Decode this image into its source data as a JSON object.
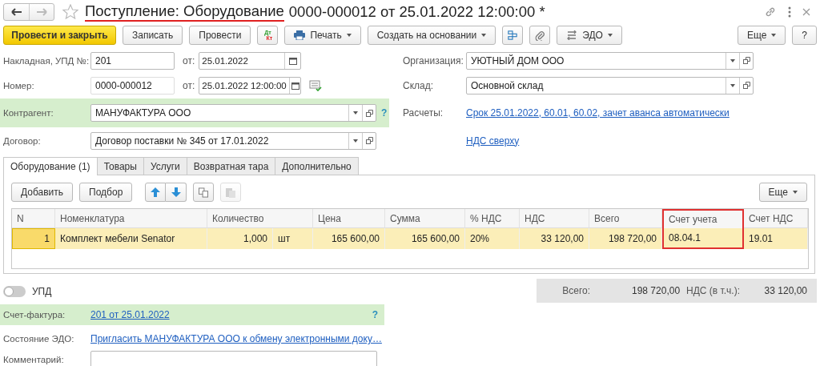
{
  "nav": [
    {
      "kind": "back",
      "disabled": false
    },
    {
      "kind": "forward",
      "disabled": true
    }
  ],
  "title": [
    {
      "text": "Поступление: Оборудование",
      "marked": true
    },
    {
      "text": "0000-000012 от 25.01.2022 12:00:00 *",
      "marked": false
    }
  ],
  "toolbar": [
    {
      "kind": "primary",
      "label": "Провести и закрыть"
    },
    {
      "kind": "plain",
      "label": "Записать"
    },
    {
      "kind": "plain",
      "label": "Провести"
    },
    {
      "kind": "dtkt",
      "top": "Дт",
      "bottom": "Кт"
    },
    {
      "kind": "print",
      "label": "Печать"
    },
    {
      "kind": "menu",
      "label": "Создать на основании"
    },
    {
      "kind": "structure"
    },
    {
      "kind": "attach"
    },
    {
      "kind": "edo",
      "label": "ЭДО"
    },
    {
      "kind": "spacer"
    },
    {
      "kind": "menu",
      "label": "Еще"
    },
    {
      "kind": "plain",
      "label": "?"
    }
  ],
  "form_left": [
    {
      "label": "Накладная, УПД №:",
      "kind": "text",
      "value": "201",
      "date_label": "от:",
      "date": "25.01.2022",
      "highlight": false
    },
    {
      "label": "Номер:",
      "kind": "number",
      "value": "0000-000012",
      "date_label": "от:",
      "date": "25.01.2022 12:00:00",
      "highlight": false
    },
    {
      "label": "Контрагент:",
      "kind": "select",
      "value": "МАНУФАКТУРА ООО",
      "help": "?",
      "highlight": true
    },
    {
      "label": "Договор:",
      "kind": "select",
      "value": "Договор поставки № 345 от 17.01.2022",
      "highlight": false
    }
  ],
  "form_right": [
    {
      "label": "Организация:",
      "kind": "select",
      "value": "УЮТНЫЙ ДОМ ООО"
    },
    {
      "label": "Склад:",
      "kind": "select",
      "value": "Основной склад"
    },
    {
      "label": "Расчеты:",
      "kind": "link",
      "value": "Срок 25.01.2022, 60.01, 60.02, зачет аванса автоматически"
    },
    {
      "kind": "link",
      "value": "НДС сверху"
    }
  ],
  "tabs": [
    {
      "label": "Оборудование (1)",
      "selected": true
    },
    {
      "label": "Товары",
      "selected": false
    },
    {
      "label": "Услуги",
      "selected": false
    },
    {
      "label": "Возвратная тара",
      "selected": false
    },
    {
      "label": "Дополнительно",
      "selected": false
    }
  ],
  "table_toolbar": [
    {
      "kind": "plain",
      "label": "Добавить",
      "disabled": false
    },
    {
      "kind": "plain",
      "label": "Подбор",
      "disabled": false
    },
    {
      "kind": "up",
      "disabled": false
    },
    {
      "kind": "down",
      "disabled": false
    },
    {
      "kind": "copy",
      "disabled": false
    },
    {
      "kind": "paste",
      "disabled": true
    },
    {
      "kind": "more",
      "label": "Еще",
      "disabled": false
    }
  ],
  "table": {
    "columns": [
      {
        "label": "N",
        "kind": "number",
        "marked": false
      },
      {
        "label": "Номенклатура",
        "kind": "text",
        "marked": false
      },
      {
        "label": "Количество",
        "kind": "number",
        "marked": false
      },
      {
        "kind": "unit",
        "marked": false
      },
      {
        "label": "Цена",
        "kind": "number",
        "marked": false
      },
      {
        "label": "Сумма",
        "kind": "number",
        "marked": false
      },
      {
        "label": "% НДС",
        "kind": "text",
        "marked": false
      },
      {
        "label": "НДС",
        "kind": "number",
        "marked": false
      },
      {
        "label": "Всего",
        "kind": "number",
        "marked": false
      },
      {
        "label": "Счет учета",
        "kind": "text",
        "marked": true
      },
      {
        "label": "Счет НДС",
        "kind": "text",
        "marked": false
      }
    ],
    "rows": [
      {
        "selected": true,
        "cells": [
          "1",
          "Комплект мебели Senator",
          "1,000",
          "шт",
          "165 600,00",
          "165 600,00",
          "20%",
          "33 120,00",
          "198 720,00",
          "08.04.1",
          "19.01"
        ]
      }
    ]
  },
  "upd": {
    "label": "УПД",
    "on": false
  },
  "totals": [
    {
      "label": "Всего:",
      "value": "198 720,00"
    },
    {
      "label": "НДС (в т.ч.):",
      "value": "33 120,00"
    }
  ],
  "invoice": {
    "label": "Счет-фактура:",
    "link": "201 от 25.01.2022",
    "help": "?"
  },
  "edo": {
    "label": "Состояние ЭДО:",
    "link": "Пригласить МАНУФАКТУРА ООО к обмену электронными доку…"
  },
  "comment": {
    "label": "Комментарий:"
  }
}
